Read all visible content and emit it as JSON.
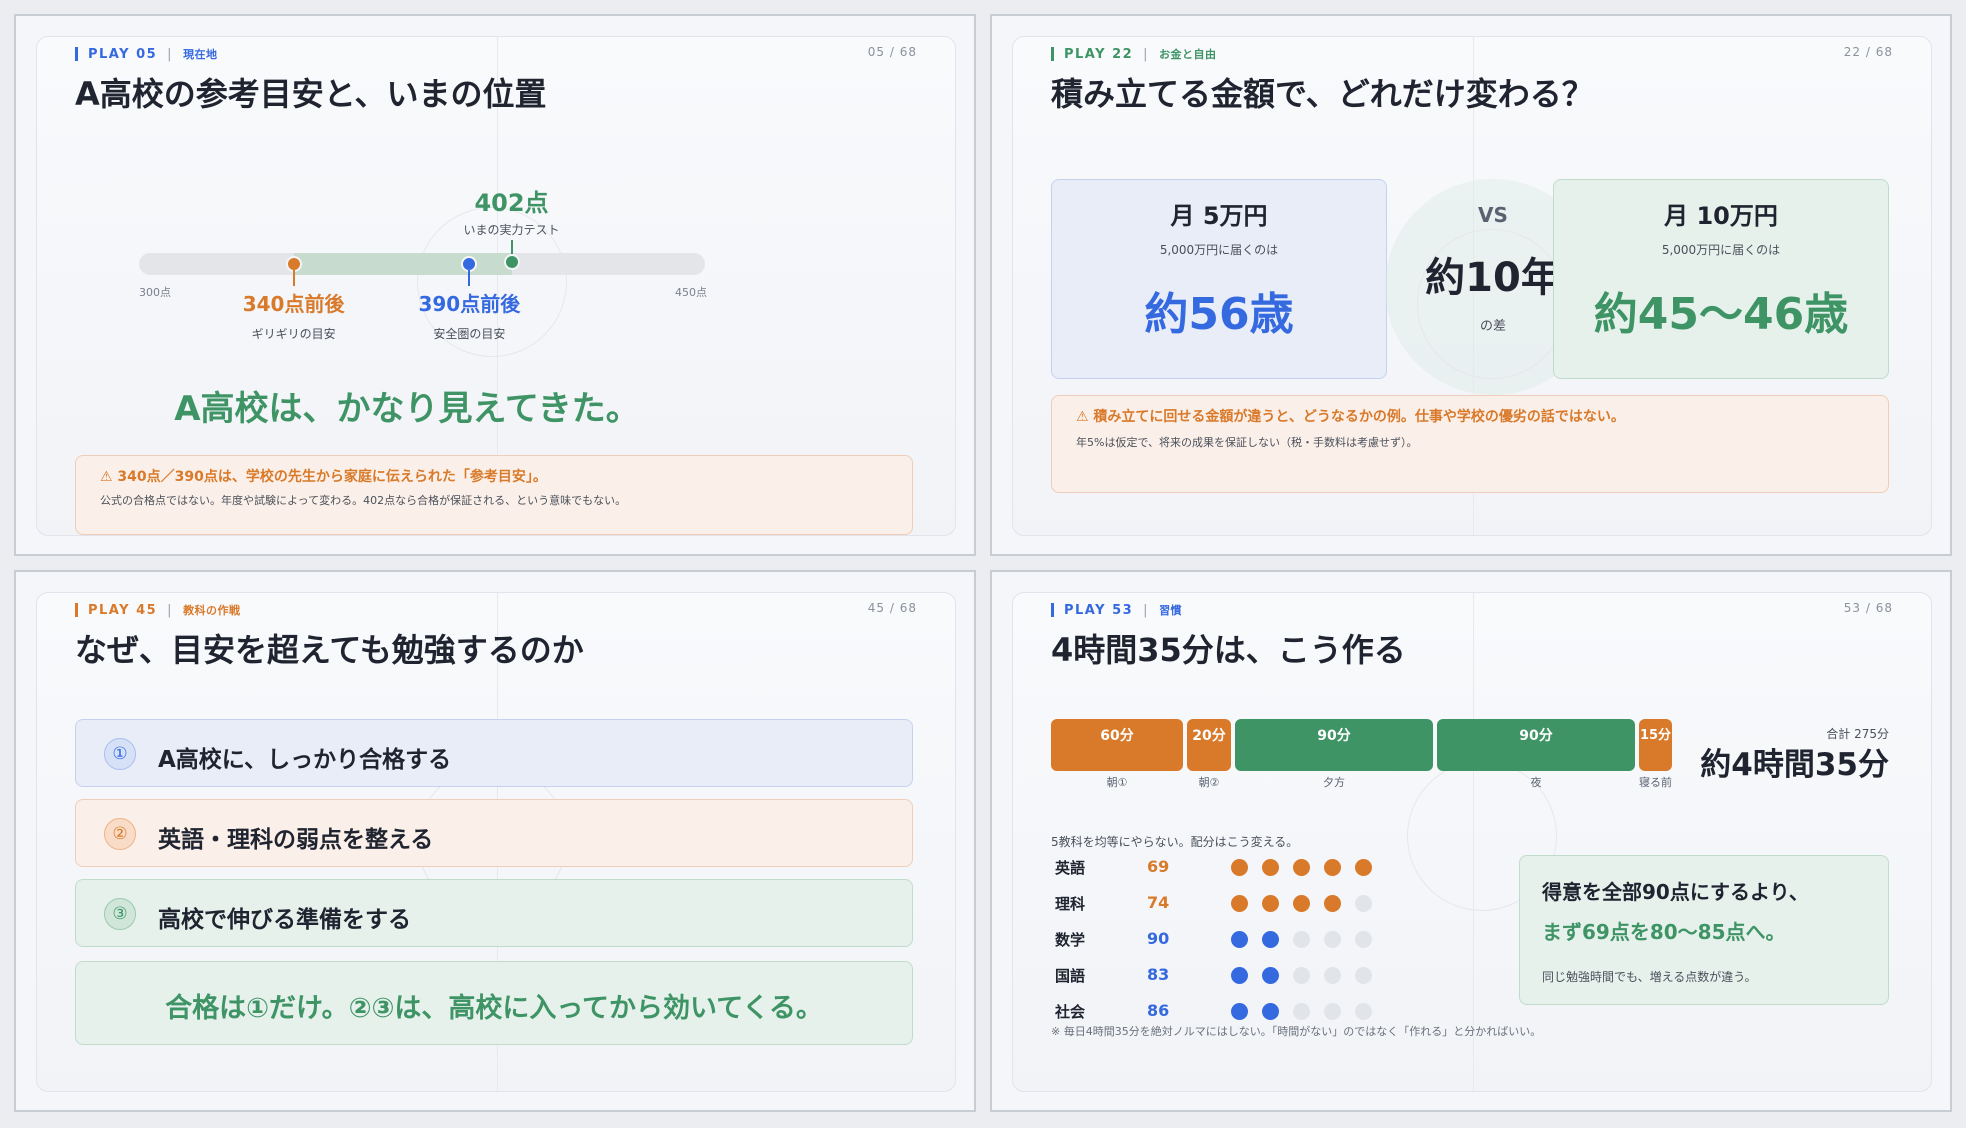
{
  "colors": {
    "blue": "#3569e0",
    "orange": "#d9792a",
    "green": "#3f9466"
  },
  "slide1": {
    "play": "PLAY 05",
    "section": "現在地",
    "page": "05 / 68",
    "title": "A高校の参考目安と、いまの位置",
    "scale": {
      "min_label": "300点",
      "max_label": "450点",
      "min": 300,
      "max": 450
    },
    "current": {
      "value": 402,
      "score": "402点",
      "label": "いまの実力テスト"
    },
    "marker_orange": {
      "value": 340,
      "score": "340点前後",
      "label": "ギリギリの目安"
    },
    "marker_blue": {
      "value": 390,
      "score": "390点前後",
      "label": "安全圏の目安"
    },
    "headline": "A高校は、かなり見えてきた。",
    "note_head": "⚠ 340点／390点は、学校の先生から家庭に伝えられた「参考目安」。",
    "note_body": "公式の合格点ではない。年度や試験によって変わる。402点なら合格が保証される、という意味でもない。"
  },
  "slide2": {
    "play": "PLAY 22",
    "section": "お金と自由",
    "page": "22 / 68",
    "title": "積み立てる金額で、どれだけ変わる？",
    "left": {
      "amount": "月 5万円",
      "caption": "5,000万円に届くのは",
      "result": "約56歳"
    },
    "vs": "VS",
    "diff": "約10年",
    "diff_sub": "の差",
    "right": {
      "amount": "月 10万円",
      "caption": "5,000万円に届くのは",
      "result": "約45〜46歳"
    },
    "note_head": "⚠ 積み立てに回せる金額が違うと、どうなるかの例。仕事や学校の優劣の話ではない。",
    "note_body": "年5%は仮定で、将来の成果を保証しない（税・手数料は考慮せず）。"
  },
  "slide3": {
    "play": "PLAY 45",
    "section": "教科の作戦",
    "page": "45 / 68",
    "title": "なぜ、目安を超えても勉強するのか",
    "items": [
      {
        "num": "①",
        "text": "A高校に、しっかり合格する"
      },
      {
        "num": "②",
        "text": "英語・理科の弱点を整える"
      },
      {
        "num": "③",
        "text": "高校で伸びる準備をする"
      }
    ],
    "summary": "合格は①だけ。②③は、高校に入ってから効いてくる。"
  },
  "slide4": {
    "play": "PLAY 53",
    "section": "習慣",
    "page": "53 / 68",
    "title": "4時間35分は、こう作る",
    "segments": [
      {
        "minutes": 60,
        "label": "60分",
        "name": "朝①",
        "color": "orange"
      },
      {
        "minutes": 20,
        "label": "20分",
        "name": "朝②",
        "color": "orange"
      },
      {
        "minutes": 90,
        "label": "90分",
        "name": "夕方",
        "color": "green"
      },
      {
        "minutes": 90,
        "label": "90分",
        "name": "夜",
        "color": "green"
      },
      {
        "minutes": 15,
        "label": "15分",
        "name": "寝る前",
        "color": "orange"
      }
    ],
    "total_label": "合計 275分",
    "total": "約4時間35分",
    "allocation_caption": "5教科を均等にやらない。配分はこう変える。",
    "subjects": [
      {
        "name": "英語",
        "score": "69",
        "dots": 5,
        "color": "orange"
      },
      {
        "name": "理科",
        "score": "74",
        "dots": 4,
        "color": "orange"
      },
      {
        "name": "数学",
        "score": "90",
        "dots": 2,
        "color": "blue"
      },
      {
        "name": "国語",
        "score": "83",
        "dots": 2,
        "color": "blue"
      },
      {
        "name": "社会",
        "score": "86",
        "dots": 2,
        "color": "blue"
      }
    ],
    "callout_line1": "得意を全部90点にするより、",
    "callout_line2": "まず69点を80〜85点へ。",
    "callout_sub": "同じ勉強時間でも、増える点数が違う。",
    "footnote": "※ 毎日4時間35分を絶対ノルマにはしない。「時間がない」のではなく「作れる」と分かればいい。"
  }
}
